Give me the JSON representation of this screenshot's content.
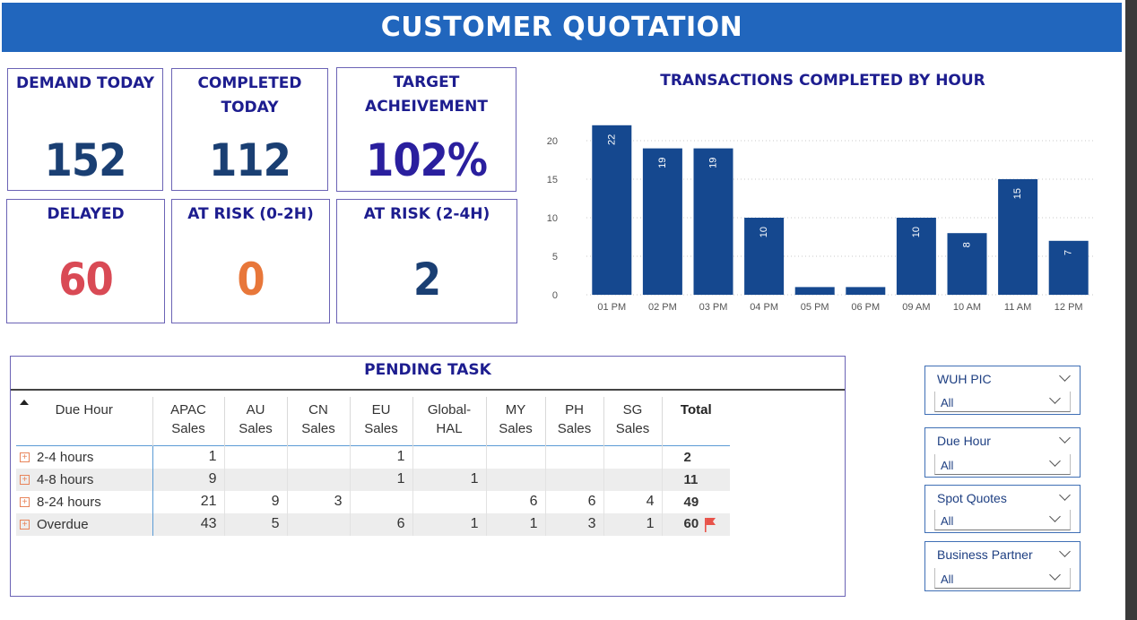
{
  "header": {
    "title": "CUSTOMER QUOTATION"
  },
  "kpis": {
    "demand": {
      "label": "DEMAND TODAY",
      "value": "152",
      "color": "#1a3f73"
    },
    "completed": {
      "label": "COMPLETED TODAY",
      "value": "112",
      "color": "#1a3f73"
    },
    "target": {
      "label": "TARGET ACHEIVEMENT",
      "value": "102%",
      "color": "#2a1f9e"
    },
    "delayed": {
      "label": "DELAYED",
      "value": "60",
      "color": "#d94a55"
    },
    "at_risk_0_2": {
      "label": "AT RISK (0-2H)",
      "value": "0",
      "color": "#e8773a"
    },
    "at_risk_2_4": {
      "label": "AT RISK (2-4H)",
      "value": "2",
      "color": "#1a3f73"
    }
  },
  "chart_data": {
    "type": "bar",
    "title": "TRANSACTIONS COMPLETED BY HOUR",
    "categories": [
      "01 PM",
      "02 PM",
      "03 PM",
      "04 PM",
      "05 PM",
      "06 PM",
      "09 AM",
      "10 AM",
      "11 AM",
      "12 PM"
    ],
    "values": [
      22,
      19,
      19,
      10,
      1,
      1,
      10,
      8,
      15,
      7
    ],
    "data_labels": [
      "22",
      "19",
      "19",
      "10",
      "",
      "",
      "10",
      "8",
      "15",
      "7"
    ],
    "yticks": [
      "0",
      "5",
      "10",
      "15",
      "20"
    ],
    "ylim": [
      0,
      22
    ],
    "xlabel": "",
    "ylabel": "",
    "grid": true,
    "bar_color": "#15488f"
  },
  "pending": {
    "title": "PENDING TASK",
    "columns": [
      "Due Hour",
      "APAC Sales",
      "AU Sales",
      "CN Sales",
      "EU Sales",
      "Global-HAL",
      "MY Sales",
      "PH Sales",
      "SG Sales",
      "Total"
    ],
    "column_lines": [
      [
        "Due Hour"
      ],
      [
        "APAC",
        "Sales"
      ],
      [
        "AU",
        "Sales"
      ],
      [
        "CN",
        "Sales"
      ],
      [
        "EU",
        "Sales"
      ],
      [
        "Global-",
        "HAL"
      ],
      [
        "MY",
        "Sales"
      ],
      [
        "PH",
        "Sales"
      ],
      [
        "SG",
        "Sales"
      ],
      [
        "Total"
      ]
    ],
    "rows": [
      {
        "label": "2-4 hours",
        "cells": [
          "1",
          "",
          "",
          "1",
          "",
          "",
          "",
          ""
        ],
        "total": "2",
        "flag": false
      },
      {
        "label": "4-8 hours",
        "cells": [
          "9",
          "",
          "",
          "1",
          "1",
          "",
          "",
          ""
        ],
        "total": "11",
        "flag": false
      },
      {
        "label": "8-24 hours",
        "cells": [
          "21",
          "9",
          "3",
          "",
          "",
          "6",
          "6",
          "4"
        ],
        "total": "49",
        "flag": false
      },
      {
        "label": "Overdue",
        "cells": [
          "43",
          "5",
          "",
          "6",
          "1",
          "1",
          "3",
          "1"
        ],
        "total": "60",
        "flag": true
      }
    ],
    "expand_icon": "plus-square-icon",
    "flag_icon": "red-flag-icon",
    "flag_color": "#e8534a"
  },
  "slicers": [
    {
      "label": "WUH PIC",
      "value": "All"
    },
    {
      "label": "Due Hour",
      "value": "All"
    },
    {
      "label": "Spot Quotes",
      "value": "All"
    },
    {
      "label": "Business Partner",
      "value": "All"
    }
  ]
}
